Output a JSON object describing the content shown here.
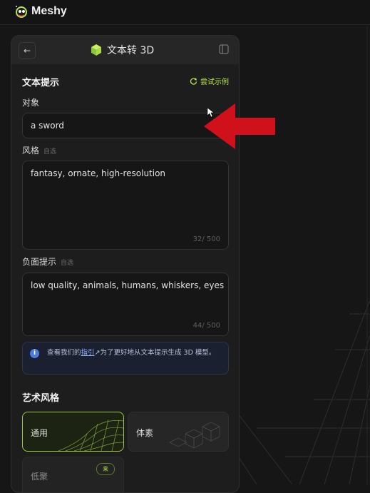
{
  "app": {
    "name": "Meshy"
  },
  "panel": {
    "back_icon": "arrow-left-icon",
    "title": "文本转 3D",
    "title_icon": "cube-icon",
    "collapse_icon": "sidebar-collapse-icon"
  },
  "text_prompt": {
    "section_title": "文本提示",
    "try_example_label": "尝试示例",
    "object": {
      "label": "对象",
      "value": "a sword"
    },
    "style": {
      "label": "风格",
      "optional": "自选",
      "value": "fantasy, ornate, high-resolution",
      "counter": "32/ 500"
    },
    "negative": {
      "label": "负面提示",
      "optional": "自选",
      "value": "low quality, animals, humans, whiskers, eyes",
      "counter": "44/ 500"
    }
  },
  "info": {
    "prefix": "查看我们的",
    "link": "指引",
    "link_icon": "↗",
    "suffix": "为了更好地从文本提示生成 3D 模型。"
  },
  "art_style": {
    "section_title": "艺术风格",
    "options": [
      {
        "label": "通用",
        "selected": true
      },
      {
        "label": "体素",
        "selected": false
      },
      {
        "label": "低聚",
        "selected": false,
        "badge": "来"
      }
    ]
  },
  "colors": {
    "accent": "#b5e34a",
    "arrow": "#d0111b",
    "info_bg": "#1a2030"
  }
}
